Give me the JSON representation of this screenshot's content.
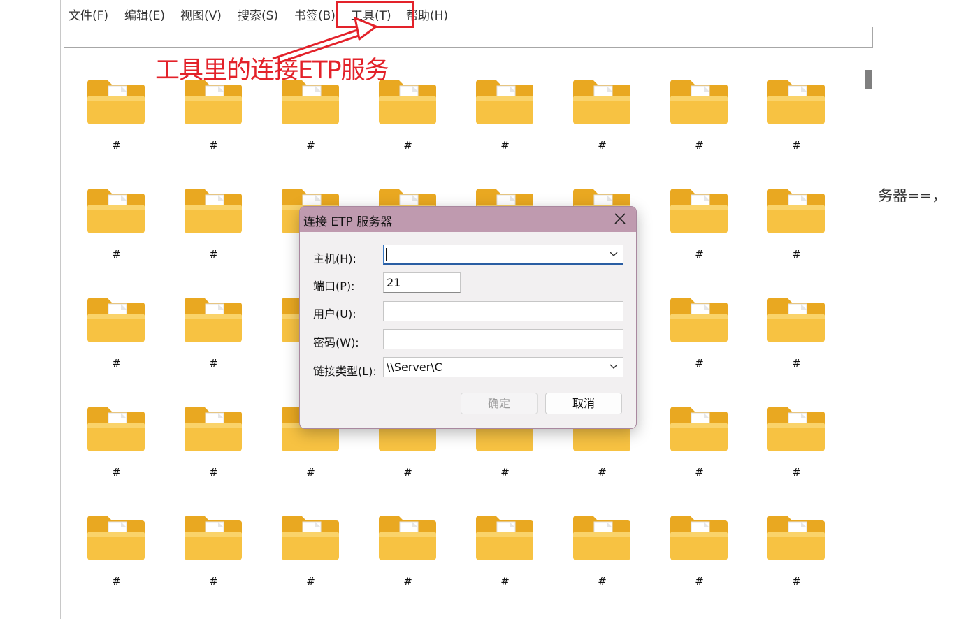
{
  "background": {
    "fragment_text": "务器==，"
  },
  "menu": {
    "items": [
      {
        "label": "文件(F)"
      },
      {
        "label": "编辑(E)"
      },
      {
        "label": "视图(V)"
      },
      {
        "label": "搜索(S)"
      },
      {
        "label": "书签(B)"
      },
      {
        "label": "工具(T)"
      },
      {
        "label": "帮助(H)"
      }
    ]
  },
  "path": {
    "value": ""
  },
  "annotation": {
    "text": "工具里的连接ETP服务",
    "color": "#e3222a"
  },
  "files": {
    "label": "#",
    "rows": 5,
    "cols": 8
  },
  "dialog": {
    "title": "连接 ETP 服务器",
    "host_label": "主机(H):",
    "host_value": "",
    "port_label": "端口(P):",
    "port_value": "21",
    "user_label": "用户(U):",
    "user_value": "",
    "password_label": "密码(W):",
    "password_value": "",
    "link_type_label": "链接类型(L):",
    "link_type_value": "\\\\Server\\C",
    "ok_label": "确定",
    "cancel_label": "取消"
  },
  "colors": {
    "title_bar": "#bf9aaf",
    "folder": "#f7c242",
    "annotation": "#e3222a"
  }
}
